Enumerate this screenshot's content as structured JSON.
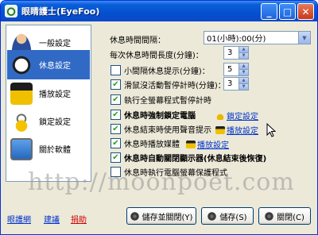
{
  "window": {
    "title": "眼睛護士(EyeFoo)"
  },
  "sidebar": {
    "items": [
      {
        "label": "一般設定",
        "icon": "person-icon"
      },
      {
        "label": "休息設定",
        "icon": "clock-icon",
        "selected": true
      },
      {
        "label": "播放設定",
        "icon": "clapperboard-icon"
      },
      {
        "label": "鎖定設定",
        "icon": "lock-icon"
      },
      {
        "label": "關於軟體",
        "icon": "monitor-icon"
      }
    ]
  },
  "settings": {
    "interval": {
      "label": "休息時間間隔：",
      "value": "01(小時):00(分)"
    },
    "break_length": {
      "label": "每次休息時間長度(分鐘)：",
      "value": "3"
    },
    "small_break": {
      "label": "小間隔休息提示(分鐘)：",
      "value": "5",
      "checked": false
    },
    "mouse_pause": {
      "label": "滑鼠沒活動暫停計時(分鐘)：",
      "value": "3",
      "checked": true
    },
    "fullscreen_pause": {
      "label": "執行全螢幕程式暫停計時",
      "checked": true
    },
    "force_lock": {
      "label": "休息時強制鎖定電腦",
      "checked": true,
      "link": "鎖定設定"
    },
    "end_sound": {
      "label": "休息結束時使用聲音提示",
      "checked": true,
      "link": "播放設定"
    },
    "play_media": {
      "label": "休息時播放媒體",
      "checked": true,
      "link": "播放設定"
    },
    "auto_monitor_off": {
      "label": "休息時自動關閉顯示器(休息結束後恢復)",
      "checked": true
    },
    "screensaver": {
      "label": "休息時執行電腦螢幕保護程式",
      "checked": false
    }
  },
  "watermark": "http://moonpoet.com",
  "footer": {
    "links": [
      "眼護網",
      "建議",
      "捐助"
    ],
    "link_colors": [
      "#0033cc",
      "#0033cc",
      "#d00000"
    ]
  },
  "buttons": {
    "save_close": "儲存並關閉(Y)",
    "save": "儲存(S)",
    "close": "關閉(C)"
  },
  "colors": {
    "accent": "#316ac5",
    "titlebar": "#0a5fd8",
    "link": "#0033cc"
  }
}
